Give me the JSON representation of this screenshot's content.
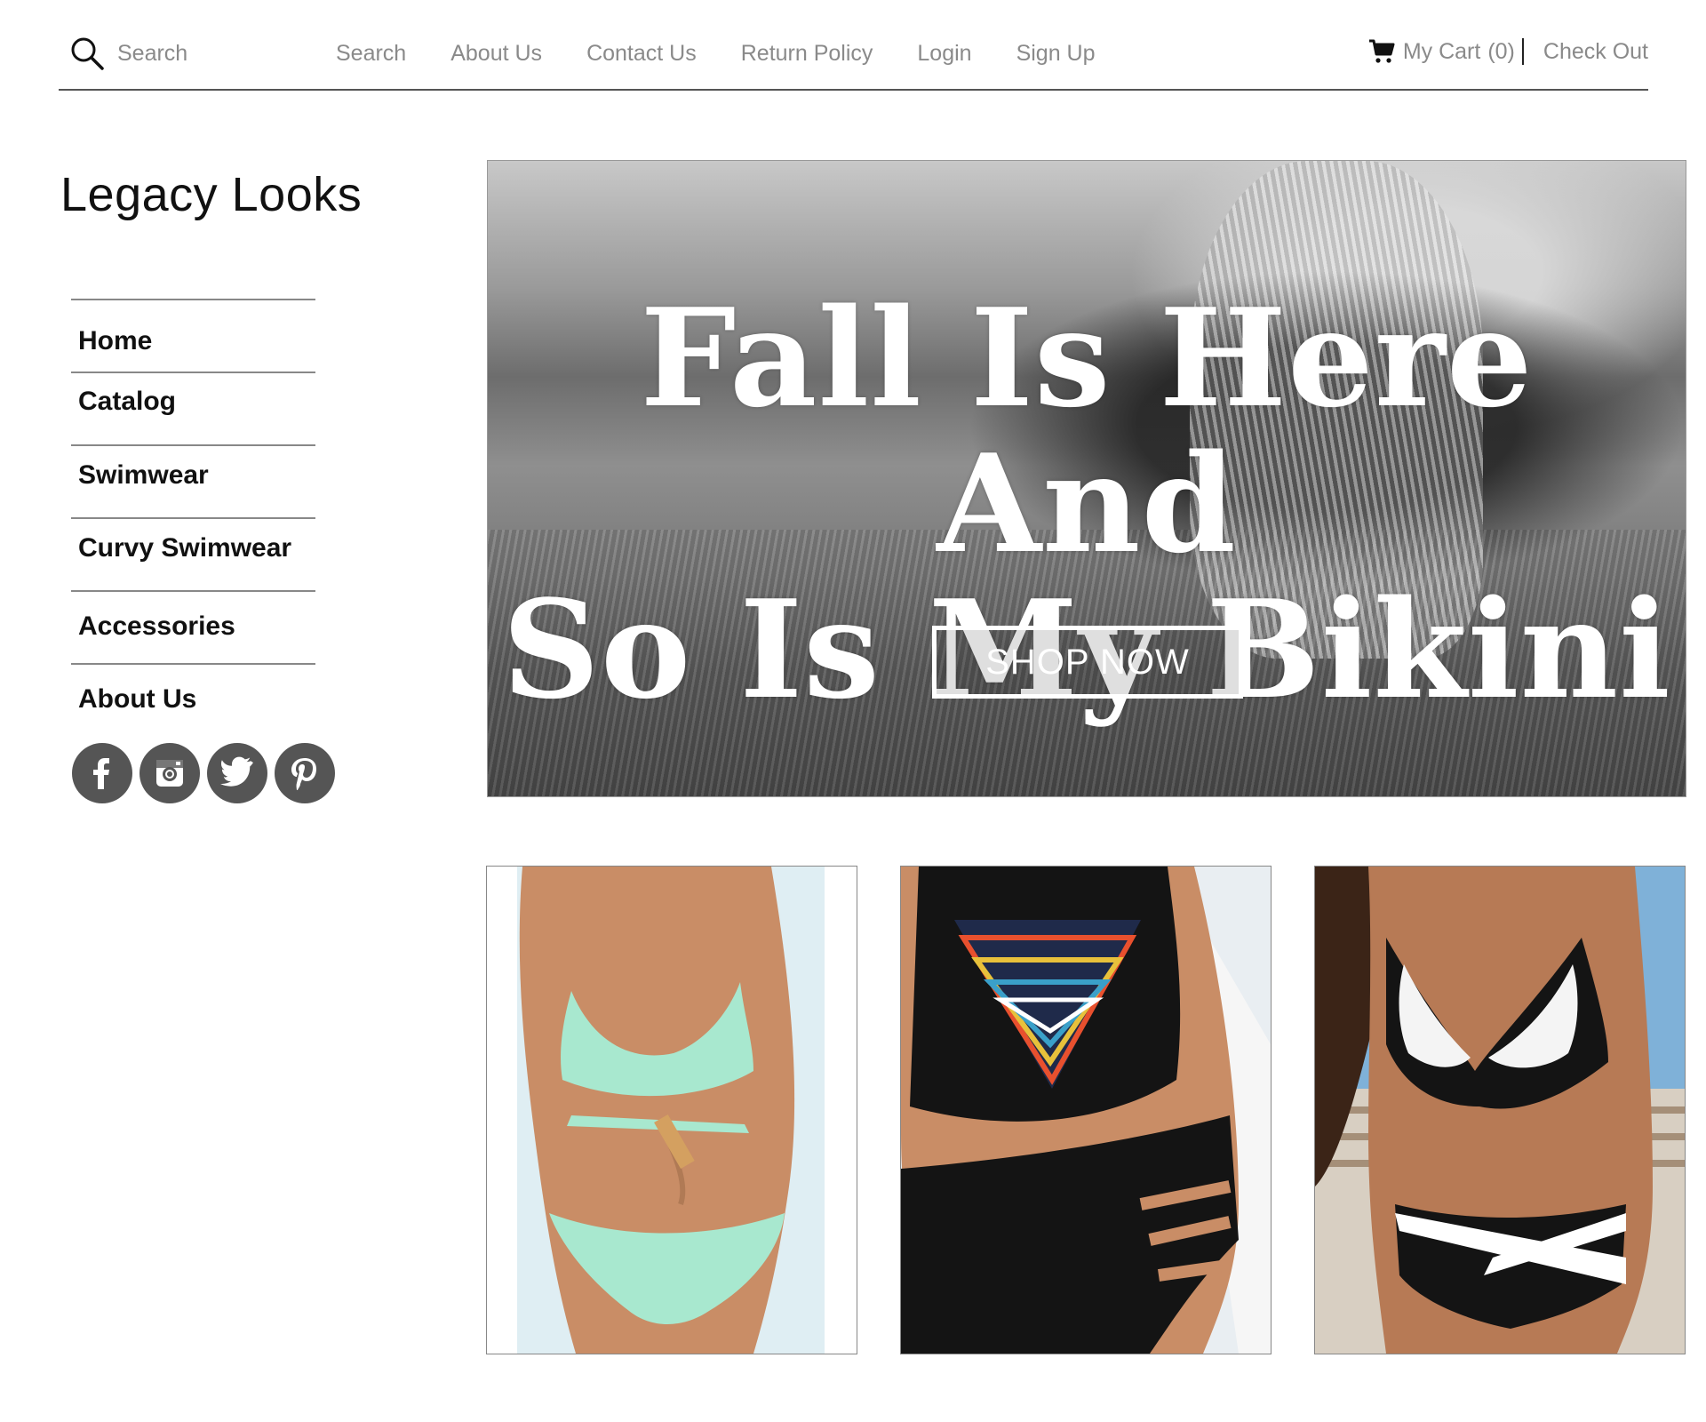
{
  "header": {
    "search_placeholder": "Search",
    "nav": [
      "Search",
      "About Us",
      "Contact Us",
      "Return Policy",
      "Login",
      "Sign Up"
    ],
    "cart_label": "My Cart",
    "cart_count": "(0)",
    "checkout_label": "Check Out"
  },
  "brand": "Legacy Looks",
  "sidebar": {
    "items": [
      "Home",
      "Catalog",
      "Swimwear",
      "Curvy Swimwear",
      "Accessories",
      "About Us"
    ],
    "social": [
      "facebook-icon",
      "instagram-icon",
      "twitter-icon",
      "pinterest-icon"
    ]
  },
  "hero": {
    "line1": "Fall Is Here And",
    "line2": "So Is My Bikini",
    "button": "SHOP NOW"
  },
  "products": [
    "mint-wrap-bikini-photo",
    "black-aztec-high-neck-bikini-photo",
    "black-white-cross-bikini-photo"
  ],
  "colors": {
    "mint": "#a8e8cf",
    "skin": "#c98d66",
    "black": "#141414",
    "icon_gray": "#555555"
  }
}
